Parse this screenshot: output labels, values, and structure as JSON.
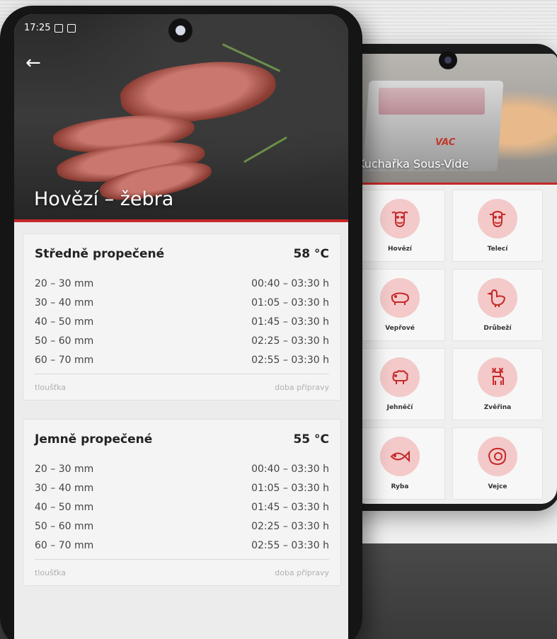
{
  "front": {
    "status_time": "17:25",
    "hero_title": "Hovězí – žebra",
    "cards": [
      {
        "title": "Středně propečené",
        "temp": "58 °C",
        "rows": [
          {
            "thickness": "20 – 30 mm",
            "time": "00:40 – 03:30 h"
          },
          {
            "thickness": "30 – 40 mm",
            "time": "01:05 – 03:30 h"
          },
          {
            "thickness": "40 – 50 mm",
            "time": "01:45 – 03:30 h"
          },
          {
            "thickness": "50 – 60 mm",
            "time": "02:25 – 03:30 h"
          },
          {
            "thickness": "60 – 70 mm",
            "time": "02:55 – 03:30 h"
          }
        ],
        "footer_left": "tloušťka",
        "footer_right": "doba přípravy"
      },
      {
        "title": "Jemně propečené",
        "temp": "55 °C",
        "rows": [
          {
            "thickness": "20 – 30 mm",
            "time": "00:40 – 03:30 h"
          },
          {
            "thickness": "30 – 40 mm",
            "time": "01:05 – 03:30 h"
          },
          {
            "thickness": "40 – 50 mm",
            "time": "01:45 – 03:30 h"
          },
          {
            "thickness": "50 – 60 mm",
            "time": "02:25 – 03:30 h"
          },
          {
            "thickness": "60 – 70 mm",
            "time": "02:55 – 03:30 h"
          }
        ],
        "footer_left": "tloušťka",
        "footer_right": "doba přípravy"
      }
    ]
  },
  "back": {
    "hero_title": "Kuchařka Sous-Vide",
    "vac_logo": "VAC",
    "categories": [
      {
        "label": "Hovězí",
        "icon": "cow-icon"
      },
      {
        "label": "Telecí",
        "icon": "calf-icon"
      },
      {
        "label": "Vepřové",
        "icon": "pig-icon"
      },
      {
        "label": "Drůbeží",
        "icon": "chicken-icon"
      },
      {
        "label": "Jehněčí",
        "icon": "sheep-icon"
      },
      {
        "label": "Zvěřina",
        "icon": "deer-icon"
      },
      {
        "label": "Ryba",
        "icon": "fish-icon"
      },
      {
        "label": "Vejce",
        "icon": "egg-icon"
      }
    ]
  },
  "colors": {
    "accent": "#c62828",
    "icon_circle": "#f3c9c9"
  }
}
